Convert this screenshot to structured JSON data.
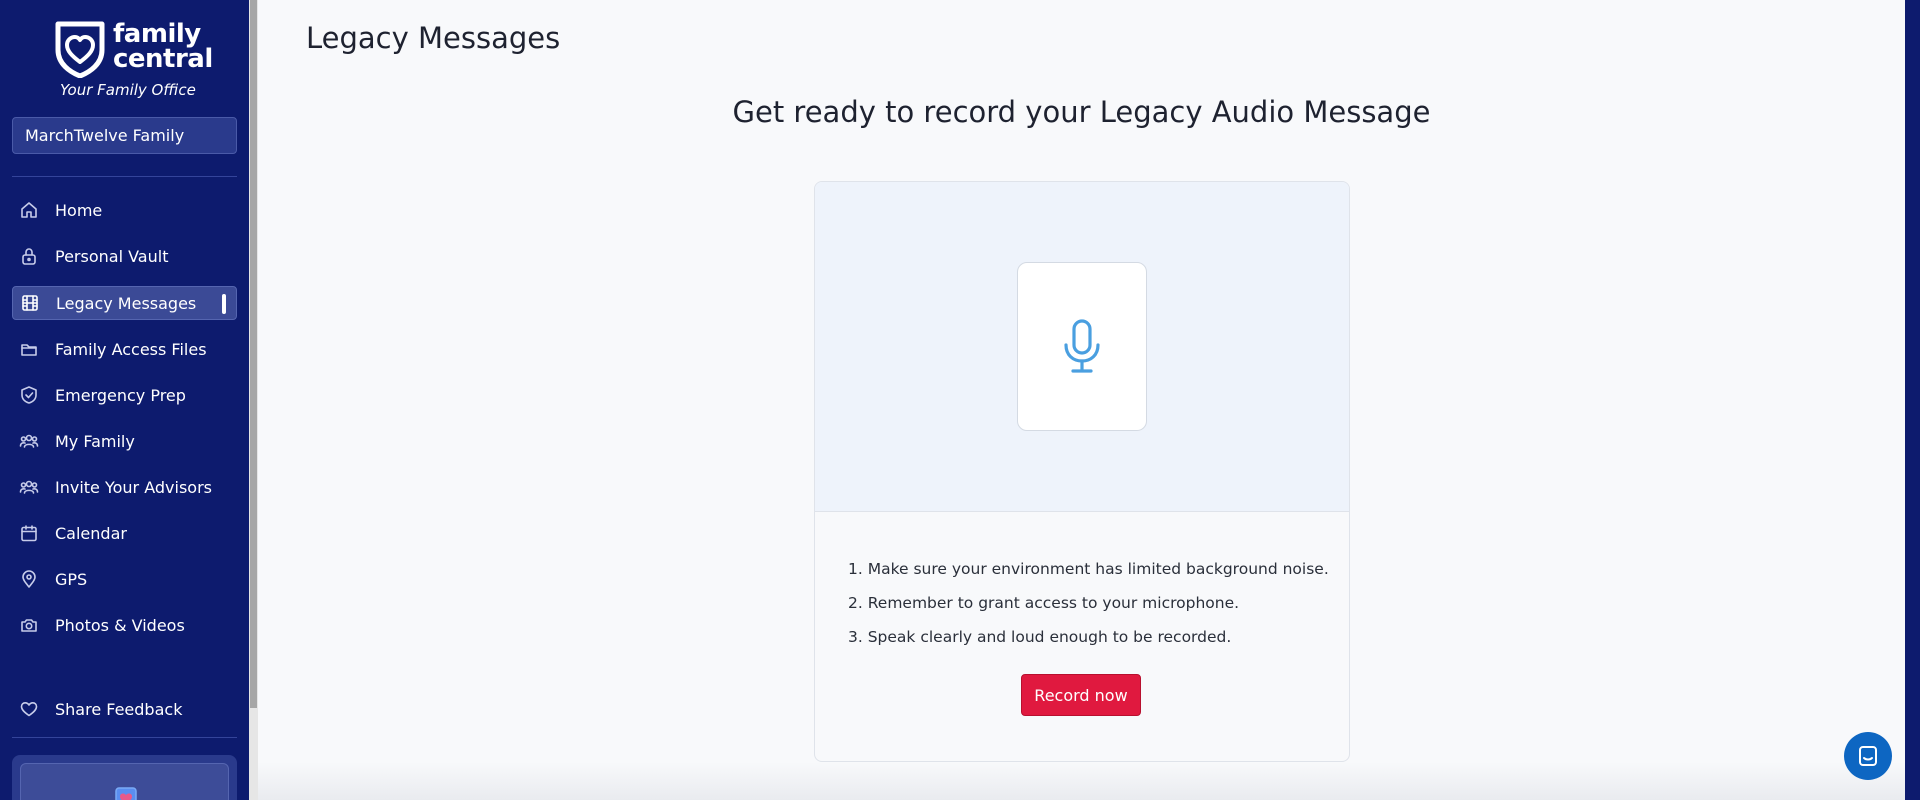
{
  "brand": {
    "name_line1": "family",
    "name_line2": "central",
    "tagline": "Your Family Office"
  },
  "family_selector": {
    "value": "MarchTwelve Family"
  },
  "nav": {
    "items": [
      {
        "label": "Home",
        "icon": "home-icon"
      },
      {
        "label": "Personal Vault",
        "icon": "lock-icon"
      },
      {
        "label": "Legacy Messages",
        "icon": "film-icon",
        "active": true
      },
      {
        "label": "Family Access Files",
        "icon": "folder-icon"
      },
      {
        "label": "Emergency Prep",
        "icon": "shield-check-icon"
      },
      {
        "label": "My Family",
        "icon": "users-icon"
      },
      {
        "label": "Invite Your Advisors",
        "icon": "users-plus-icon"
      },
      {
        "label": "Calendar",
        "icon": "calendar-icon"
      },
      {
        "label": "GPS",
        "icon": "map-pin-icon"
      },
      {
        "label": "Photos & Videos",
        "icon": "camera-icon"
      }
    ],
    "feedback": {
      "label": "Share Feedback",
      "icon": "heart-icon"
    }
  },
  "main": {
    "page_title": "Legacy Messages",
    "heading": "Get ready to record your Legacy Audio Message",
    "steps": [
      "1. Make sure your environment has limited background noise.",
      "2. Remember to grant access to your microphone.",
      "3. Speak clearly and loud enough to be recorded."
    ],
    "record_button": "Record now",
    "mic_icon": "microphone-icon"
  },
  "colors": {
    "sidebar_bg": "#0d1b6e",
    "accent_red": "#e0193f",
    "mic_blue": "#4a9fe0",
    "chat_blue": "#0d66c2"
  }
}
